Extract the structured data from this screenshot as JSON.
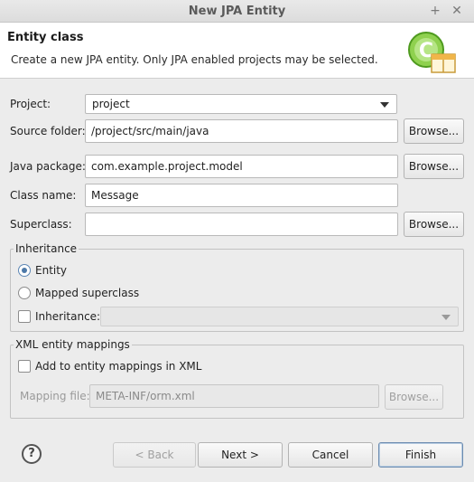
{
  "window": {
    "title": "New JPA Entity"
  },
  "header": {
    "title": "Entity class",
    "description": "Create a new JPA entity. Only JPA enabled projects may be selected."
  },
  "form": {
    "project_label": "Project:",
    "project_value": "project",
    "source_folder_label": "Source folder:",
    "source_folder_value": "/project/src/main/java",
    "java_package_label": "Java package:",
    "java_package_value": "com.example.project.model",
    "class_name_label": "Class name:",
    "class_name_value": "Message",
    "superclass_label": "Superclass:",
    "superclass_value": "",
    "browse_label": "Browse..."
  },
  "inheritance": {
    "group_title": "Inheritance",
    "entity_label": "Entity",
    "entity_checked": true,
    "mapped_superclass_label": "Mapped superclass",
    "mapped_superclass_checked": false,
    "inheritance_label": "Inheritance:",
    "inheritance_checked": false,
    "inheritance_value": ""
  },
  "xml": {
    "group_title": "XML entity mappings",
    "add_label": "Add to entity mappings in XML",
    "add_checked": false,
    "mapping_file_label": "Mapping file:",
    "mapping_file_value": "META-INF/orm.xml",
    "browse_label": "Browse..."
  },
  "footer": {
    "back_label": "< Back",
    "next_label": "Next >",
    "cancel_label": "Cancel",
    "finish_label": "Finish",
    "help_glyph": "?"
  },
  "colors": {
    "accent": "#4d79a8",
    "default_button_border": "#6b8bb0"
  }
}
